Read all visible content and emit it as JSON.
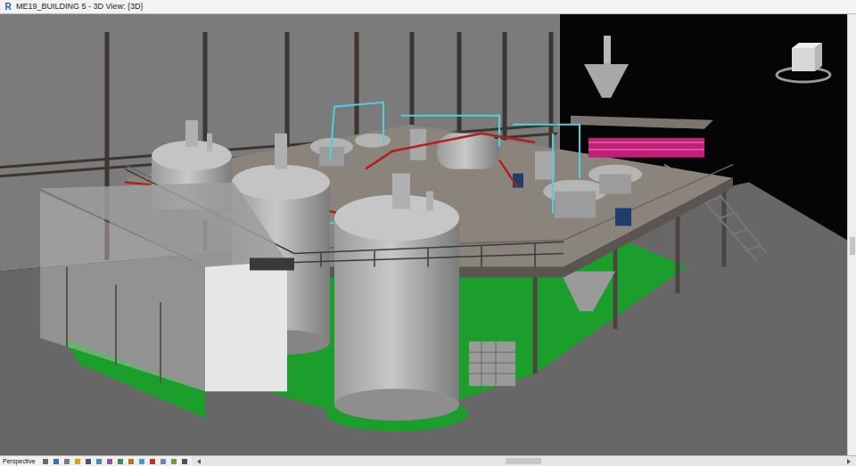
{
  "window": {
    "title": "ME19_BUILDING 5 - 3D View: {3D}",
    "app_icon": "R"
  },
  "view_control_bar": {
    "view_mode": "Perspective"
  }
}
